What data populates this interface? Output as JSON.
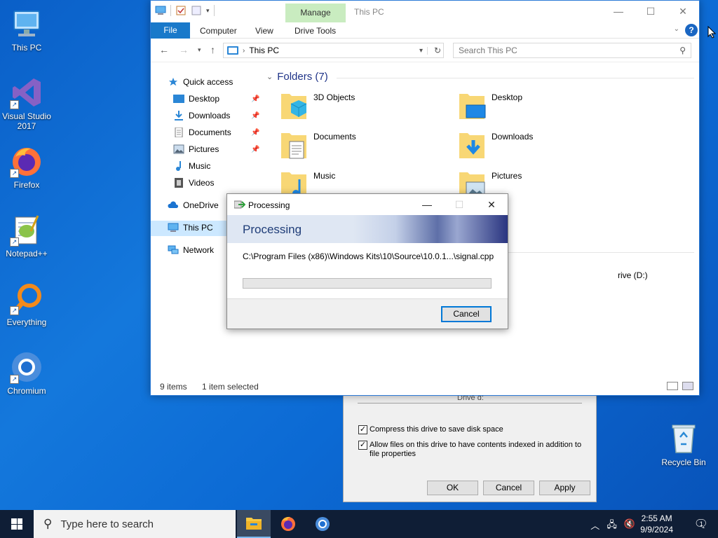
{
  "desktop": {
    "icons": [
      {
        "label": "This PC"
      },
      {
        "label": "Visual Studio 2017"
      },
      {
        "label": "Firefox"
      },
      {
        "label": "Notepad++"
      },
      {
        "label": "Everything"
      },
      {
        "label": "Chromium"
      },
      {
        "label": "Recycle Bin"
      }
    ]
  },
  "explorer": {
    "title": "This PC",
    "context_tab": "Manage",
    "tabs": {
      "file": "File",
      "computer": "Computer",
      "view": "View",
      "drive_tools": "Drive Tools"
    },
    "address": "This PC",
    "search_placeholder": "Search This PC",
    "nav": {
      "quick_access": "Quick access",
      "desktop": "Desktop",
      "downloads": "Downloads",
      "documents": "Documents",
      "pictures": "Pictures",
      "music": "Music",
      "videos": "Videos",
      "onedrive": "OneDrive",
      "this_pc": "This PC",
      "network": "Network"
    },
    "folders_header": "Folders (7)",
    "folders": {
      "objects3d": "3D Objects",
      "desktop": "Desktop",
      "documents": "Documents",
      "downloads": "Downloads",
      "music": "Music",
      "pictures": "Pictures"
    },
    "drive_fragment": "rive (D:)",
    "status": {
      "items": "9 items",
      "selected": "1 item selected"
    }
  },
  "properties": {
    "partial_label": "Drive d:",
    "compress_label": "Compress this drive to save disk space",
    "index_label": "Allow files on this drive to have contents indexed in addition to file properties",
    "ok": "OK",
    "cancel": "Cancel",
    "apply": "Apply"
  },
  "processing": {
    "window_title": "Processing",
    "heading": "Processing",
    "path": "C:\\Program Files (x86)\\Windows Kits\\10\\Source\\10.0.1...\\signal.cpp",
    "progress": 0,
    "cancel": "Cancel"
  },
  "taskbar": {
    "search_placeholder": "Type here to search",
    "time": "2:55 AM",
    "date": "9/9/2024",
    "notifications": "1"
  },
  "colors": {
    "accent": "#1979ca",
    "manage_tab": "#c9ecc0",
    "taskbar": "#0f1e36"
  }
}
